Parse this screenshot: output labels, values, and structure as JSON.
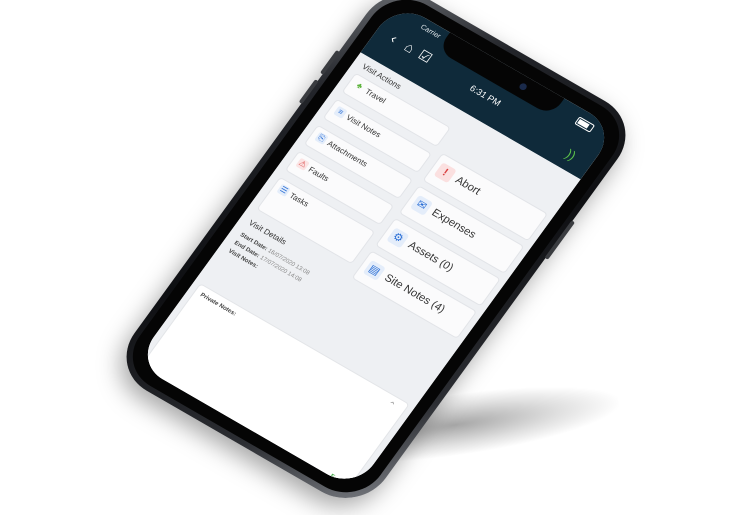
{
  "status_bar": {
    "carrier": "Carrier",
    "time": "6:31 PM"
  },
  "header_icons": [
    "chevron-left-icon",
    "home-icon",
    "clipboard-check-icon"
  ],
  "visit_actions": {
    "title": "Visit Actions",
    "small_tiles": [
      {
        "label": "Travel",
        "icon": "travel-icon"
      },
      {
        "label": "Visit Notes",
        "icon": "notes-icon"
      },
      {
        "label": "Attachments",
        "icon": "attachment-icon"
      },
      {
        "label": "Faults",
        "icon": "fault-icon"
      },
      {
        "label": "Tasks",
        "icon": "tasks-icon"
      }
    ],
    "big_tiles": [
      {
        "label": "Abort",
        "icon": "abort-icon"
      },
      {
        "label": "Expenses",
        "icon": "expenses-icon"
      },
      {
        "label": "Assets (0)",
        "icon": "assets-icon"
      },
      {
        "label": "Site Notes (4)",
        "icon": "site-notes-icon"
      }
    ]
  },
  "visit_details": {
    "title": "Visit Details",
    "start_date_label": "Start Date:",
    "start_date_value": "16/07/2020 13:08",
    "end_date_label": "End Date:",
    "end_date_value": "17/07/2020 14:08",
    "visit_notes_label": "Visit Notes:"
  },
  "private_notes": {
    "label": "Private Notes:"
  },
  "colors": {
    "header": "#0f2a3a",
    "accent_green": "#5bc24a",
    "accent_blue": "#2b6fd6",
    "abort_red": "#d94040"
  }
}
